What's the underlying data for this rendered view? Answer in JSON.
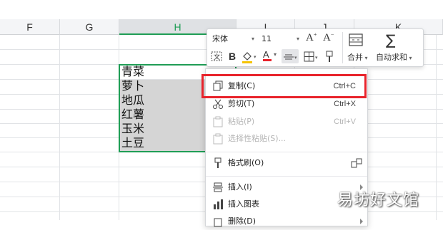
{
  "sheet": {
    "columns": [
      "F",
      "G",
      "H",
      "I",
      "J",
      "K"
    ],
    "selected_column": "H",
    "cells": [
      "青菜",
      "萝卜",
      "地瓜",
      "红薯",
      "玉米",
      "土豆"
    ]
  },
  "toolbar": {
    "font_name": "宋体",
    "font_size": "11",
    "bold": "B",
    "font_color_letter": "A",
    "merge_label": "合并",
    "autosum_label": "自动求和"
  },
  "context_menu": {
    "items": [
      {
        "label": "复制(C)",
        "shortcut": "Ctrl+C",
        "icon": "copy-icon",
        "enabled": true
      },
      {
        "label": "剪切(T)",
        "shortcut": "Ctrl+X",
        "icon": "scissors-icon",
        "enabled": true
      },
      {
        "label": "粘贴(P)",
        "shortcut": "Ctrl+V",
        "icon": "paste-icon",
        "enabled": false
      },
      {
        "label": "选择性粘贴(S)...",
        "shortcut": "",
        "icon": "paste-special-icon",
        "enabled": false
      },
      {
        "label": "格式刷(O)",
        "shortcut": "",
        "icon": "format-brush-icon",
        "enabled": true
      },
      {
        "label": "插入(I)",
        "shortcut": "",
        "icon": "insert-icon",
        "enabled": true
      },
      {
        "label": "插入图表",
        "shortcut": "",
        "icon": "chart-icon",
        "enabled": true
      },
      {
        "label": "删除(D)",
        "shortcut": "",
        "icon": "delete-icon",
        "enabled": true
      }
    ]
  },
  "colors": {
    "selection_green": "#1f9d55",
    "highlight_red": "#e8232b",
    "cell_shading": "#d5d5d5"
  },
  "watermark": "易坊好文馆"
}
